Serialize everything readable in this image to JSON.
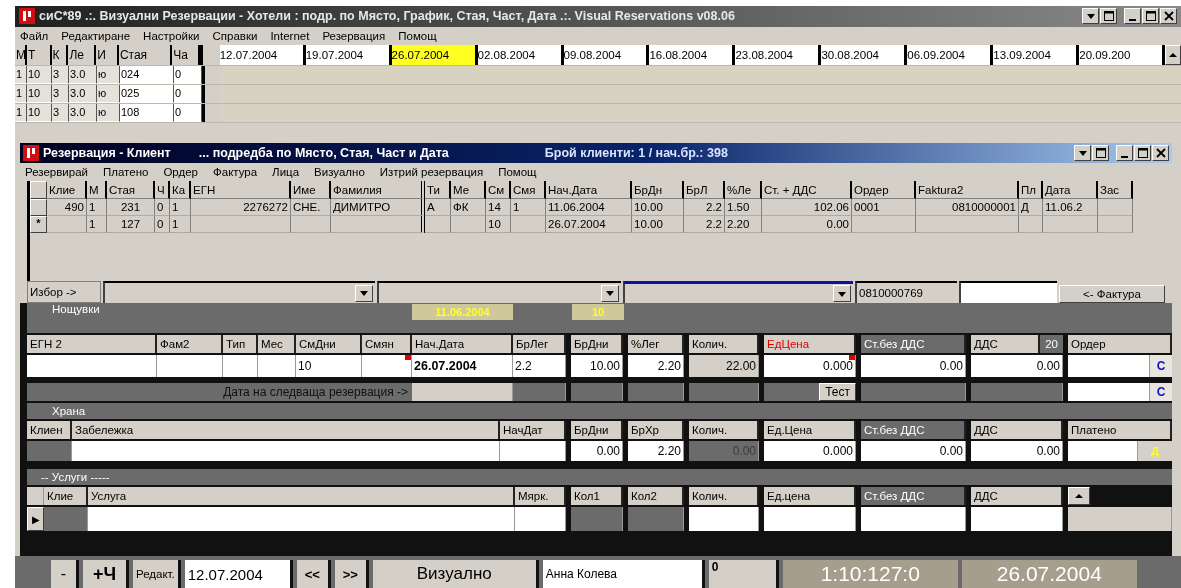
{
  "window": {
    "title": "сиС*89 .:. Визуални  Резервации - Хотели : подр. по Място, График, Стая, Част, Дата .:. Visual Reservations v08.06",
    "menu": [
      "Файл",
      "Редактиране",
      "Настройки",
      "Справки",
      "Internet",
      "Резервация",
      "Помощ"
    ]
  },
  "schedule": {
    "columns": [
      "М",
      "Т",
      "К",
      "Ле",
      "И",
      "Стая",
      "Ча"
    ],
    "dates": [
      {
        "label": "12.07.2004",
        "selected": false
      },
      {
        "label": "19.07.2004",
        "selected": false
      },
      {
        "label": "26.07.2004",
        "selected": true
      },
      {
        "label": "02.08.2004",
        "selected": false
      },
      {
        "label": "09.08.2004",
        "selected": false
      },
      {
        "label": "16.08.2004",
        "selected": false
      },
      {
        "label": "23.08.2004",
        "selected": false
      },
      {
        "label": "30.08.2004",
        "selected": false
      },
      {
        "label": "06.09.2004",
        "selected": false
      },
      {
        "label": "13.09.2004",
        "selected": false
      },
      {
        "label": "20.09.200",
        "selected": false
      }
    ],
    "rows": [
      [
        "1",
        "10",
        "3",
        "3.0",
        "ю",
        "024",
        "0"
      ],
      [
        "1",
        "10",
        "3",
        "3.0",
        "ю",
        "025",
        "0"
      ],
      [
        "1",
        "10",
        "3",
        "3.0",
        "ю",
        "108",
        "0"
      ]
    ]
  },
  "reservation_window": {
    "title": "Резервация - Клиент",
    "subtitle": "... подредба по Място, Стая, Част и Дата",
    "count": "Брой клиенти: 1 / нач.бр.: 398",
    "menu": [
      "Резервирай",
      "Платено",
      "Ордер",
      "Фактура",
      "Лица",
      "Визуално",
      "Изтрий резервация",
      "Помощ"
    ],
    "clients": {
      "columns": [
        "Клие",
        "М",
        "Стая",
        "Ч",
        "Ка",
        "ЕГН",
        "Име",
        "Фамилия",
        "Ти",
        "Ме",
        "См",
        "Смя",
        "Нач.Дата",
        "БрДн",
        "БрЛ",
        "%Ле",
        "Ст. + ДДС",
        "Ордер",
        "Faktura2",
        "Пл",
        "Дата",
        "Зас"
      ],
      "rows": [
        {
          "cells": [
            "490",
            "1",
            "231",
            "0",
            "1",
            "2276272",
            "СНЕ.",
            "ДИМИТРО",
            "А",
            "ФК",
            "14",
            "1",
            "11.06.2004",
            "10.00",
            "2.2",
            "1.50",
            "102.06",
            "0001",
            "0810000001",
            "Д",
            "11.06.2",
            null
          ]
        },
        {
          "marker": "*",
          "cells": [
            null,
            "1",
            "127",
            "0",
            "1",
            null,
            null,
            null,
            null,
            null,
            "10",
            null,
            "26.07.2004",
            "10.00",
            "2.2",
            "2.20",
            "0.00",
            null,
            null,
            null,
            null,
            null
          ]
        }
      ]
    },
    "selector": {
      "label": "Избор ->",
      "invoice_number": "0810000769",
      "invoice_button": "<- Фактура"
    },
    "nights": {
      "title": "Нощувки",
      "start_date": "11.06.2004",
      "days": "10",
      "columns": [
        {
          "label": "ЕГН 2"
        },
        {
          "label": "Фам2"
        },
        {
          "label": "Тип"
        },
        {
          "label": "Мес"
        },
        {
          "label": "СмДни"
        },
        {
          "label": "Смян"
        },
        {
          "label": "Нач.Дата"
        },
        {
          "label": "БрЛег"
        }
      ],
      "amount_columns": [
        {
          "label": "БрДни",
          "kind": "plain"
        },
        {
          "label": "%Лег",
          "kind": "plain"
        },
        {
          "label": "Колич.",
          "kind": "plain"
        },
        {
          "label": "ЕдЦена",
          "kind": "alert"
        },
        {
          "label": "Ст.без ДДС",
          "kind": "dark"
        },
        {
          "label": "ДДС",
          "kind": "plain",
          "rate": "20"
        },
        {
          "label": "Ордер",
          "kind": "plain"
        }
      ],
      "values": [
        {
          "kind": "field"
        },
        {
          "kind": "field"
        },
        {
          "kind": "field"
        },
        {
          "kind": "field"
        },
        {
          "kind": "field",
          "text": "10"
        },
        {
          "kind": "flagged"
        },
        {
          "kind": "date",
          "text": "26.07.2004"
        },
        {
          "kind": "field",
          "text": "2.2"
        }
      ],
      "amounts": [
        {
          "kind": "field",
          "text": "10.00"
        },
        {
          "kind": "field",
          "text": "2.20"
        },
        {
          "kind": "readonly",
          "text": "22.00"
        },
        {
          "kind": "flagged",
          "text": "0.000"
        },
        {
          "kind": "field",
          "text": "0.00"
        },
        {
          "kind": "field",
          "text": "0.00"
        },
        {
          "kind": "code",
          "button": "C"
        }
      ],
      "next_label": "Дата на следваща резервация ->",
      "test_button": "Тест",
      "next_code_button": "C"
    },
    "food": {
      "title": "Храна",
      "columns": [
        {
          "label": "Клиен"
        },
        {
          "label": "Забележка"
        },
        {
          "label": "НачДат"
        }
      ],
      "amount_columns": [
        {
          "label": "БрДни",
          "kind": "plain"
        },
        {
          "label": "БрХр",
          "kind": "plain"
        },
        {
          "label": "Колич.",
          "kind": "plain"
        },
        {
          "label": "Ед.Цена",
          "kind": "plain"
        },
        {
          "label": "Ст.без ДДС",
          "kind": "dark"
        },
        {
          "label": "ДДС",
          "kind": "plain"
        },
        {
          "label": "Платено",
          "kind": "plain"
        }
      ],
      "values": [
        {
          "kind": "blank"
        },
        {
          "kind": "field"
        },
        {
          "kind": "field"
        }
      ],
      "amounts": [
        {
          "kind": "field",
          "text": "0.00"
        },
        {
          "kind": "field",
          "text": "2.20"
        },
        {
          "kind": "dim",
          "text": "0.00"
        },
        {
          "kind": "field",
          "text": "0.000"
        },
        {
          "kind": "field",
          "text": "0.00"
        },
        {
          "kind": "field",
          "text": "0.00"
        },
        {
          "kind": "paid",
          "button": "Д"
        }
      ]
    },
    "services": {
      "title": "-- Услуги -----",
      "row_marker": "▶",
      "columns": [
        {
          "label": "Клие"
        },
        {
          "label": "Услуга"
        },
        {
          "label": "Мярк."
        }
      ],
      "amount_columns": [
        {
          "label": "Кол1",
          "kind": "plain"
        },
        {
          "label": "Кол2",
          "kind": "plain"
        },
        {
          "label": "Колич.",
          "kind": "plain"
        },
        {
          "label": "Ед.цена",
          "kind": "plain"
        },
        {
          "label": "Ст.без ДДС",
          "kind": "dark"
        },
        {
          "label": "ДДС",
          "kind": "plain"
        }
      ],
      "values": [
        {
          "kind": "blank"
        },
        {
          "kind": "field"
        },
        {
          "kind": "field"
        }
      ],
      "amounts": [
        {
          "kind": "blank"
        },
        {
          "kind": "blank"
        },
        {
          "kind": "field"
        },
        {
          "kind": "field"
        },
        {
          "kind": "field"
        },
        {
          "kind": "field"
        }
      ]
    }
  },
  "status_bar": {
    "minus_button": "-",
    "add_button": "+Ч",
    "edit_label": "Редакт.",
    "date": "12.07.2004",
    "prev_button": "<<",
    "next_button": ">>",
    "view_button": "Визуално",
    "user": "Анна Колева",
    "counter": "0",
    "code": "1:10:127:0",
    "current_date": "26.07.2004"
  }
}
